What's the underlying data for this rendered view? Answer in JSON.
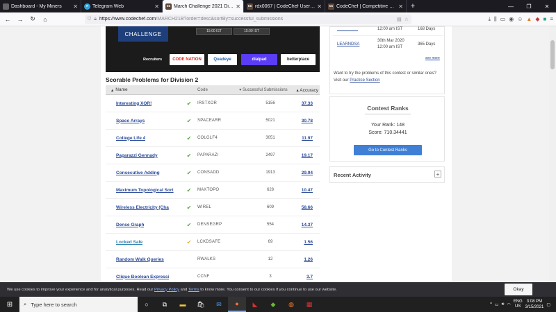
{
  "browser": {
    "tabs": [
      {
        "title": "Dashboard - My Miners",
        "icon": "page-icon",
        "active": false
      },
      {
        "title": "Telegram Web",
        "icon": "telegram-icon",
        "active": false
      },
      {
        "title": "March Challenge 2021 Division",
        "icon": "codechef-icon",
        "active": true
      },
      {
        "title": "rdx0067 | CodeChef User Profil",
        "icon": "codechef-icon",
        "active": false
      },
      {
        "title": "CodeChef | Competitive Progra",
        "icon": "codechef-icon",
        "active": false
      }
    ],
    "url_host": "https://www.codechef.com",
    "url_path": "/MARCH21B?order=desc&sortBy=successful_submissions"
  },
  "banner": {
    "challenge": "CHALLENGE",
    "time_left": "15:00 IST",
    "time_right": "15:00 IST",
    "recruiters_label": "Recruiters",
    "logos": [
      "CODE NATION",
      "Quadeye",
      "dialpad",
      "betterplace"
    ]
  },
  "problems": {
    "title": "Scorable Problems for Division 2",
    "headers": {
      "name": "Name",
      "code": "Code",
      "subs": "Successful Submissions",
      "acc": "Accuracy"
    },
    "rows": [
      {
        "name": "Interesting XOR!",
        "code": "IRSTXOR",
        "subs": "5156",
        "acc": "37.33",
        "status": "solved"
      },
      {
        "name": "Space Arrays",
        "code": "SPACEARR",
        "subs": "5021",
        "acc": "30.78",
        "status": "solved"
      },
      {
        "name": "College Life 4",
        "code": "COLGLF4",
        "subs": "3051",
        "acc": "11.97",
        "status": "solved"
      },
      {
        "name": "Paparazzi Gennady",
        "code": "PAPARAZI",
        "subs": "2497",
        "acc": "19.17",
        "status": "solved"
      },
      {
        "name": "Consecutive Adding",
        "code": "CONSADD",
        "subs": "1913",
        "acc": "29.94",
        "status": "solved"
      },
      {
        "name": "Maximum Topological Sort",
        "code": "MAXTOPO",
        "subs": "628",
        "acc": "10.47",
        "status": "solved"
      },
      {
        "name": "Wireless Electricity (Cha",
        "code": "WIREL",
        "subs": "609",
        "acc": "58.66",
        "status": "solved"
      },
      {
        "name": "Dense Graph",
        "code": "DENSEGRP",
        "subs": "554",
        "acc": "14.37",
        "status": "solved"
      },
      {
        "name": "Locked Safe",
        "code": "LCKDSAFE",
        "subs": "69",
        "acc": "1.56",
        "status": "partial"
      },
      {
        "name": "Random Walk Queries",
        "code": "RWALKS",
        "subs": "12",
        "acc": "1.26",
        "status": "none"
      },
      {
        "name": "Clique Boolean Expressi",
        "code": "CCNF",
        "subs": "3",
        "acc": "3.7",
        "status": "none"
      }
    ]
  },
  "sidebar": {
    "contest_rows": [
      {
        "date": "12:00 am IST",
        "days": "168 Days"
      },
      {
        "code": "LEARNDSA",
        "date": "30th Mar 2020",
        "time": "12:00 am IST",
        "days": "365 Days"
      }
    ],
    "see_more": "see more",
    "practice_text": "Want to try the problems of this contest or similar ones? Visit our",
    "practice_link": "Practice Section",
    "ranks_title": "Contest Ranks",
    "your_rank": "Your Rank: 148",
    "score": "Score: 710.34441",
    "ranks_button": "Go to Contest Ranks",
    "recent_activity": "Recent Activity"
  },
  "cookie": {
    "text_a": "We use cookies to improve your experience and for analytical purposes. Read our",
    "privacy": "Privacy Policy",
    "and": "and",
    "terms": "Terms",
    "text_b": "to know more. You consent to our cookies if you continue to use our website.",
    "okay": "Okay"
  },
  "taskbar": {
    "search_placeholder": "Type here to search",
    "lang_top": "ENG",
    "lang_bottom": "US",
    "time": "3:08 PM",
    "date": "3/15/2021"
  },
  "colors": {
    "accent": "#3f7fd6",
    "link": "#2a4a9a",
    "solved": "#59a442",
    "partial": "#e0b030"
  }
}
